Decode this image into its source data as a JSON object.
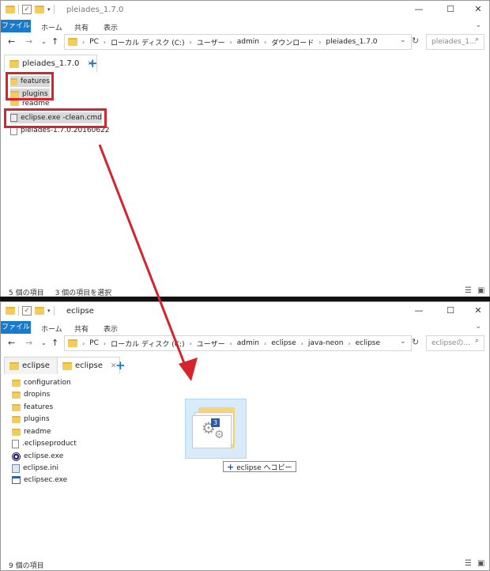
{
  "window1": {
    "title": "pleiades_1.7.0",
    "ribbon_tabs": [
      "ファイル",
      "ホーム",
      "共有",
      "表示"
    ],
    "breadcrumb": [
      "PC",
      "ローカル ディスク (C:)",
      "ユーザー",
      "admin",
      "ダウンロード",
      "pleiades_1.7.0"
    ],
    "search_placeholder": "pleiades_1...",
    "tab_label": "pleiades_1.7.0",
    "items": [
      {
        "name": "features",
        "icon": "folder-icon"
      },
      {
        "name": "plugins",
        "icon": "folder-icon"
      },
      {
        "name": "readme",
        "icon": "folder-icon"
      },
      {
        "name": "eclipse.exe -clean.cmd",
        "icon": "cmd-file-icon"
      },
      {
        "name": "pleiades-1.7.0.20160622",
        "icon": "file-icon"
      }
    ],
    "status_count": "5 個の項目",
    "status_selected": "3 個の項目を選択"
  },
  "window2": {
    "title": "eclipse",
    "ribbon_tabs": [
      "ファイル",
      "ホーム",
      "共有",
      "表示"
    ],
    "breadcrumb": [
      "PC",
      "ローカル ディスク (C:)",
      "ユーザー",
      "admin",
      "eclipse",
      "java-neon",
      "eclipse"
    ],
    "search_placeholder": "eclipseの...",
    "tabs": [
      {
        "label": "eclipse",
        "active": false
      },
      {
        "label": "eclipse",
        "active": true
      }
    ],
    "items": [
      {
        "name": "configuration",
        "icon": "folder-icon"
      },
      {
        "name": "dropins",
        "icon": "folder-icon"
      },
      {
        "name": "features",
        "icon": "folder-icon"
      },
      {
        "name": "plugins",
        "icon": "folder-icon"
      },
      {
        "name": "readme",
        "icon": "folder-icon"
      },
      {
        "name": ".eclipseproduct",
        "icon": "file-icon"
      },
      {
        "name": "eclipse.exe",
        "icon": "eclipse-exe-icon"
      },
      {
        "name": "eclipse.ini",
        "icon": "ini-file-icon"
      },
      {
        "name": "eclipsec.exe",
        "icon": "exe-icon"
      }
    ],
    "status_count": "9 個の項目"
  },
  "drag": {
    "count_badge": "3",
    "copy_tooltip": "eclipse へコピー"
  },
  "colors": {
    "accent": "#1979ca",
    "highlight": "#d5242b",
    "selection": "#d9d9d9",
    "drag_bg": "#d7ebfa"
  }
}
